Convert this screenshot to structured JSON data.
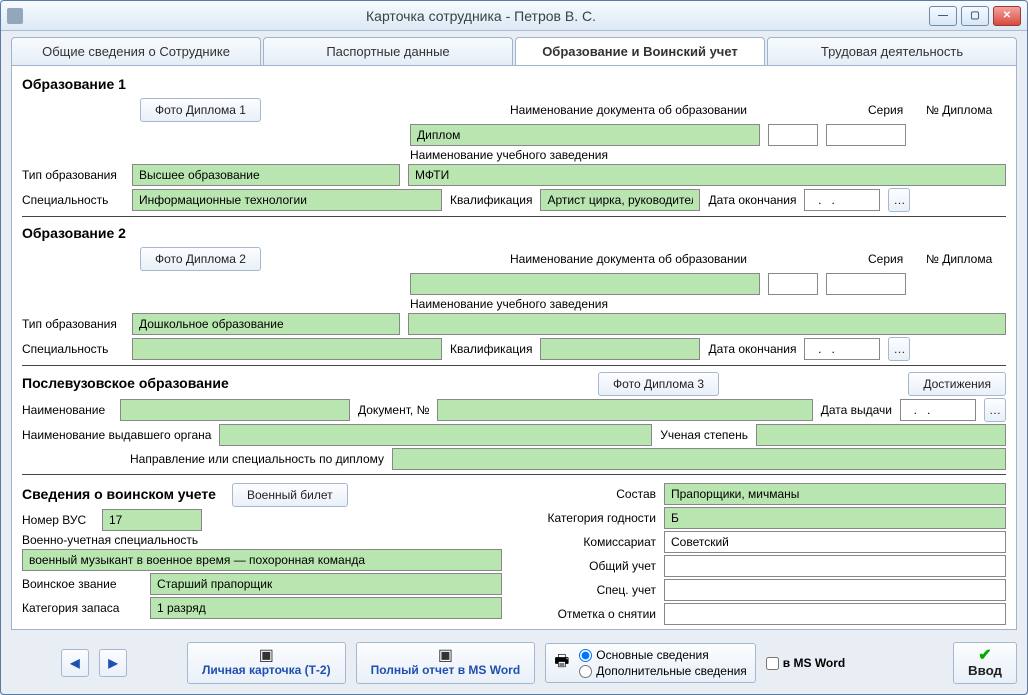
{
  "window": {
    "title": "Карточка сотрудника  -   Петров В. С."
  },
  "tabs": {
    "t1": "Общие сведения о Сотруднике",
    "t2": "Паспортные данные",
    "t3": "Образование и Воинский учет",
    "t4": "Трудовая деятельность"
  },
  "edu1": {
    "heading": "Образование 1",
    "photoBtn": "Фото Диплома 1",
    "docNameLabel": "Наименование документа об образовании",
    "docName": "Диплом",
    "seriesLabel": "Серия",
    "series": "",
    "diplomaNoLabel": "№ Диплома",
    "diplomaNo": "",
    "typeLabel": "Тип образования",
    "type": "Высшее образование",
    "instLabel": "Наименование учебного заведения",
    "inst": "МФТИ",
    "specLabel": "Специальность",
    "spec": "Информационные технологии",
    "qualLabel": "Квалификация",
    "qual": "Артист цирка, руководитель ц",
    "endLabel": "Дата окончания",
    "end": "  .   .   "
  },
  "edu2": {
    "heading": "Образование 2",
    "photoBtn": "Фото Диплома 2",
    "docNameLabel": "Наименование документа об образовании",
    "docName": "",
    "seriesLabel": "Серия",
    "series": "",
    "diplomaNoLabel": "№ Диплома",
    "diplomaNo": "",
    "typeLabel": "Тип образования",
    "type": "Дошкольное образование",
    "instLabel": "Наименование учебного заведения",
    "inst": "",
    "specLabel": "Специальность",
    "spec": "",
    "qualLabel": "Квалификация",
    "qual": "",
    "endLabel": "Дата окончания",
    "end": "  .   .   "
  },
  "post": {
    "heading": "Послевузовское образование",
    "photoBtn": "Фото Диплома 3",
    "achBtn": "Достижения",
    "nameLabel": "Наименование",
    "name": "",
    "docNoLabel": "Документ, №",
    "docNo": "",
    "issueDateLabel": "Дата выдачи",
    "issueDate": "  .   .   ",
    "issuerLabel": "Наименование выдавшего органа",
    "issuer": "",
    "degreeLabel": "Ученая степень",
    "degree": "",
    "directionLabel": "Направление или специальность по диплому",
    "direction": ""
  },
  "mil": {
    "heading": "Сведения о воинском учете",
    "ticketBtn": "Военный билет",
    "vusLabel": "Номер ВУС",
    "vus": "17",
    "vusSpecLabel": "Военно-учетная специальность",
    "vusSpec": "военный музыкант в военное время — похоронная команда",
    "rankLabel": "Воинское звание",
    "rank": "Старший прапорщик",
    "reserveLabel": "Категория запаса",
    "reserve": "1 разряд",
    "compLabel": "Состав",
    "comp": "Прапорщики, мичманы",
    "fitLabel": "Категория годности",
    "fit": "Б",
    "commLabel": "Комиссариат",
    "comm": "Советский",
    "generalLabel": "Общий учет",
    "general": "",
    "specAcctLabel": "Спец. учет",
    "specAcct": "",
    "removeLabel": "Отметка о снятии",
    "remove": ""
  },
  "bottom": {
    "t2": "Личная карточка (Т-2)",
    "report": "Полный отчет в MS Word",
    "radioMain": "Основные сведения",
    "radioExtra": "Дополнительные сведения",
    "wordCheck": "в MS Word",
    "enter": "Ввод"
  }
}
